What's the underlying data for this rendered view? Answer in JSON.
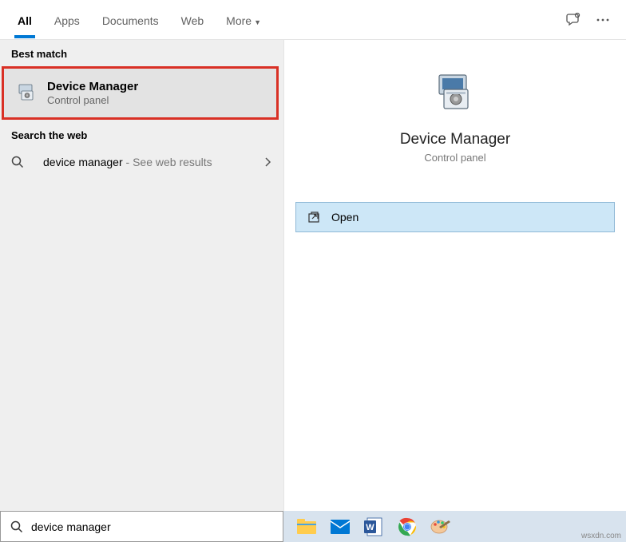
{
  "tabs": {
    "all": "All",
    "apps": "Apps",
    "documents": "Documents",
    "web": "Web",
    "more": "More"
  },
  "sections": {
    "best_match": "Best match",
    "search_web": "Search the web"
  },
  "result": {
    "title": "Device Manager",
    "subtitle": "Control panel"
  },
  "web_result": {
    "query": "device manager",
    "suffix": " - See web results"
  },
  "preview": {
    "title": "Device Manager",
    "subtitle": "Control panel"
  },
  "action": {
    "open": "Open"
  },
  "search": {
    "value": "device manager"
  },
  "watermark": "wsxdn.com"
}
